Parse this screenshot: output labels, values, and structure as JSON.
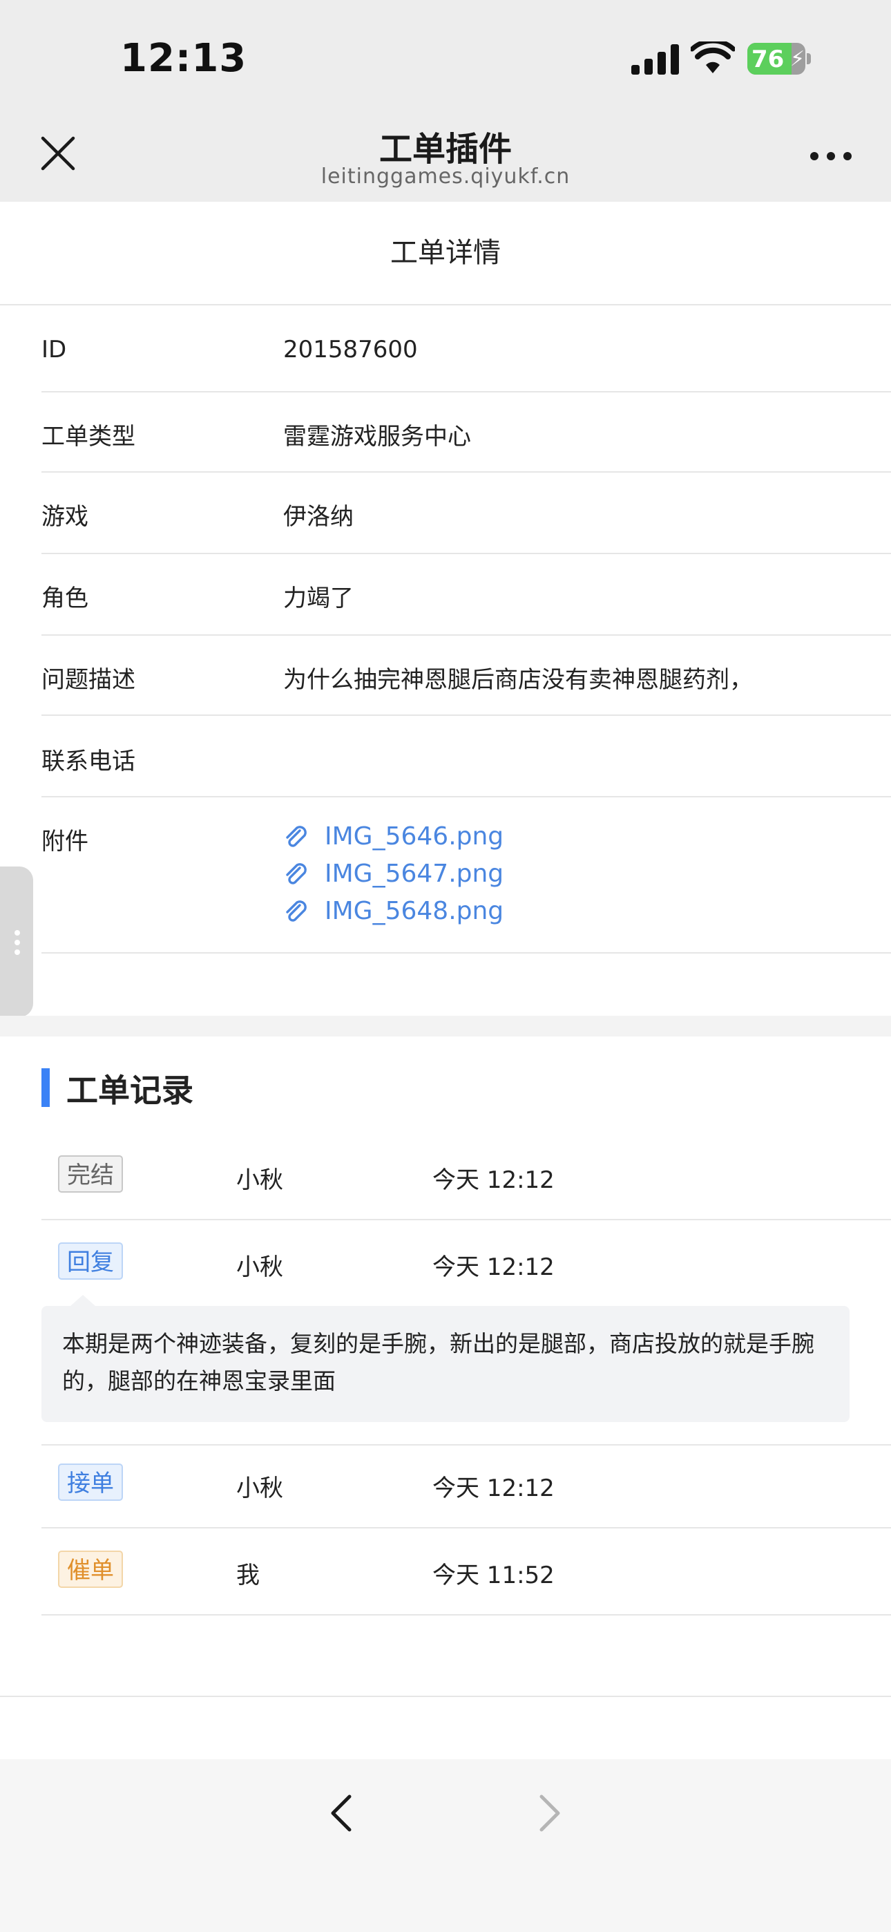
{
  "status": {
    "time": "12:13",
    "battery": "76",
    "battery_level": 0.76
  },
  "nav": {
    "title": "工单插件",
    "subtitle": "leitinggames.qiyukf.cn"
  },
  "detail": {
    "title": "工单详情",
    "fields": [
      {
        "label": "ID",
        "value": "201587600"
      },
      {
        "label": "工单类型",
        "value": "雷霆游戏服务中心"
      },
      {
        "label": "游戏",
        "value": "伊洛纳"
      },
      {
        "label": "角色",
        "value": "力竭了"
      },
      {
        "label": "问题描述",
        "value": "为什么抽完神恩腿后商店没有卖神恩腿药剂，"
      },
      {
        "label": "联系电话",
        "value": ""
      },
      {
        "label": "附件",
        "value": ""
      }
    ],
    "attachments": [
      "IMG_5646.png",
      "IMG_5647.png",
      "IMG_5648.png"
    ]
  },
  "records": {
    "title": "工单记录",
    "items": [
      {
        "tag": "完结",
        "tag_color": "#666666",
        "who": "小秋",
        "when": "今天 12:12"
      },
      {
        "tag": "回复",
        "tag_color": "#3f7fe0",
        "who": "小秋",
        "when": "今天 12:12",
        "message": "本期是两个神迹装备，复刻的是手腕，新出的是腿部，商店投放的就是手腕的，腿部的在神恩宝录里面"
      },
      {
        "tag": "接单",
        "tag_color": "#3f7fe0",
        "who": "小秋",
        "when": "今天 12:12"
      },
      {
        "tag": "催单",
        "tag_color": "#e0902c",
        "who": "我",
        "when": "今天 11:52"
      }
    ]
  }
}
